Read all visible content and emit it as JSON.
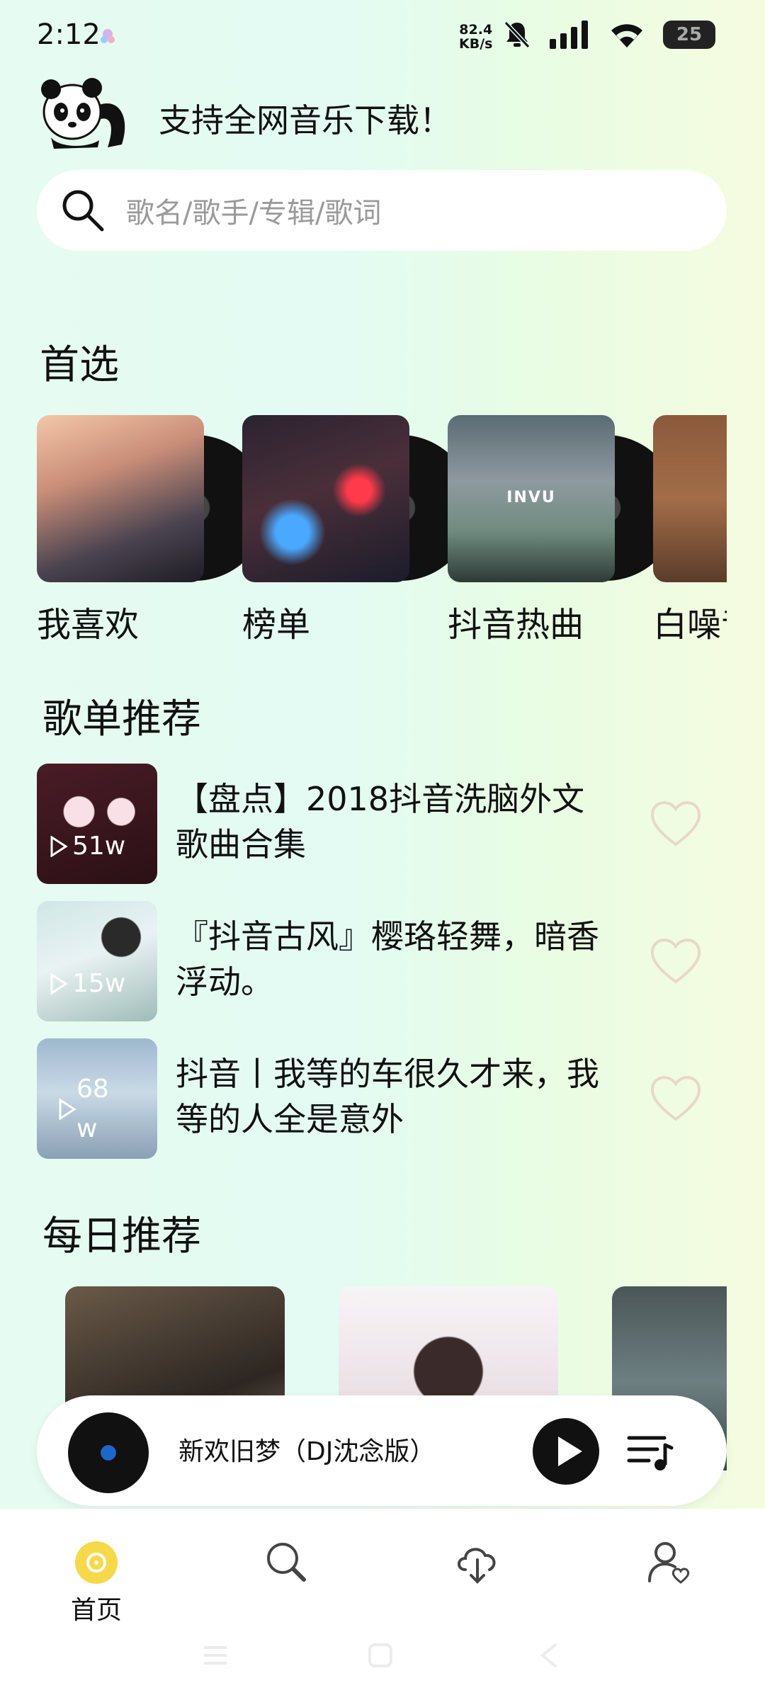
{
  "status_bar": {
    "time": "2:12",
    "net_speed_value": "82.4",
    "net_speed_unit": "KB/s",
    "battery": "25"
  },
  "header": {
    "slogan": "支持全网音乐下载！"
  },
  "search": {
    "placeholder": "歌名/歌手/专辑/歌词"
  },
  "featured": {
    "title": "首选",
    "items": [
      {
        "label": "我喜欢"
      },
      {
        "label": "榜单"
      },
      {
        "label": "抖音热曲",
        "cover_text": "INVU"
      },
      {
        "label": "白噪音"
      }
    ]
  },
  "playlists": {
    "title": "歌单推荐",
    "items": [
      {
        "title": "【盘点】2018抖音洗脑外文歌曲合集",
        "plays": "51w"
      },
      {
        "title": "『抖音古风』樱珞轻舞，暗香浮动。",
        "plays": "15w"
      },
      {
        "title": "抖音丨我等的车很久才来，我等的人全是意外",
        "plays": "68w"
      }
    ]
  },
  "daily": {
    "title": "每日推荐"
  },
  "mini_player": {
    "song": "新欢旧梦（DJ沈念版）"
  },
  "bottom_nav": {
    "home": "首页"
  },
  "colors": {
    "accent_yellow": "#f6d94a",
    "heart_outline": "#e7d8c8"
  }
}
